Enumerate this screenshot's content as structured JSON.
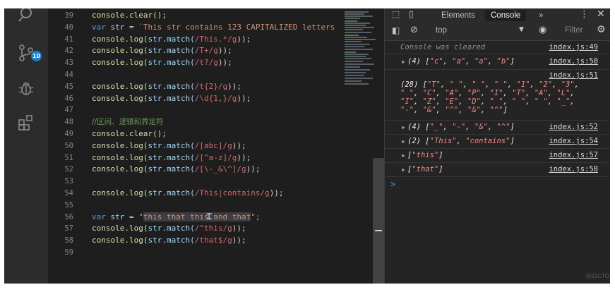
{
  "activity_bar": {
    "source_control_badge": "10"
  },
  "editor": {
    "lines": [
      {
        "num": "39"
      },
      {
        "num": "40"
      },
      {
        "num": "41"
      },
      {
        "num": "42"
      },
      {
        "num": "43"
      },
      {
        "num": "44"
      },
      {
        "num": "45"
      },
      {
        "num": "46"
      },
      {
        "num": "47"
      },
      {
        "num": "48"
      },
      {
        "num": "49"
      },
      {
        "num": "50"
      },
      {
        "num": "51"
      },
      {
        "num": "52"
      },
      {
        "num": "53"
      },
      {
        "num": "54"
      },
      {
        "num": "55"
      },
      {
        "num": "56"
      },
      {
        "num": "57"
      },
      {
        "num": "58"
      },
      {
        "num": "59"
      }
    ],
    "code": {
      "l39": "console.clear();",
      "l40_a": "var",
      "l40_b": "str",
      "l40_c": " = ",
      "l40_d": "`This str contains 123 CAPITALIZED letters",
      "l41": "/This.*/g",
      "l42": "/T+/g",
      "l43": "/t?/g",
      "l45": "/t{2}/g",
      "l46": "/\\d{1,}/g",
      "l48": "//区间、逻辑和界定符",
      "l49": "console.clear();",
      "l50": "/[abc]/g",
      "l51": "/[^a-z]/g",
      "l52": "/[\\-_&\\^]/g",
      "l54": "/This|contains/g",
      "l56_open": "\"",
      "l56_str": "this that this and that",
      "l56_close": "\";",
      "l57": "/^this/g",
      "l58": "/that$/g",
      "log_prefix": "console.log(",
      "match_prefix": "str.match(",
      "log_suffix": "));"
    }
  },
  "devtools": {
    "tabs": {
      "elements": "Elements",
      "console": "Console",
      "more": "»"
    },
    "toolbar": {
      "context": "top",
      "filter_placeholder": "Filter"
    },
    "messages": [
      {
        "text": "Console was cleared",
        "source": "index.js:49"
      },
      {
        "count": "(4)",
        "items": [
          "\"c\"",
          "\"a\"",
          "\"a\"",
          "\"b\""
        ],
        "source": "index.js:50"
      },
      {
        "count": "(28)",
        "source": "index.js:51",
        "wrap1": [
          "\"T\"",
          "\" \"",
          "\" \"",
          "\" \"",
          "\"1\"",
          "\"2\"",
          "\"3\""
        ],
        "wrap2": [
          "\" \"",
          "\"C\"",
          "\"A\"",
          "\"P\"",
          "\"I\"",
          "\"T\"",
          "\"A\"",
          "\"L\""
        ],
        "wrap3": [
          "\"I\"",
          "\"Z\"",
          "\"E\"",
          "\"D\"",
          "\" \"",
          "\" \"",
          "\" \"",
          "\"_\""
        ],
        "wrap4": [
          "\"-\"",
          "\"&\"",
          "\"^\"",
          "\"&\"",
          "\"^\""
        ]
      },
      {
        "count": "(4)",
        "items": [
          "\"_\"",
          "\"-\"",
          "\"&\"",
          "\"^\""
        ],
        "source": "index.js:52"
      },
      {
        "count": "(2)",
        "items": [
          "\"This\"",
          "\"contains\""
        ],
        "source": "index.js:54"
      },
      {
        "items": [
          "\"this\""
        ],
        "source": "index.js:57"
      },
      {
        "items": [
          "\"that\""
        ],
        "source": "index.js:58"
      }
    ],
    "prompt": ">"
  },
  "watermark": "@51CTO",
  "colors": {
    "editor_bg": "#1e1e1e",
    "keyword": "#569cd6",
    "function": "#dcdcaa",
    "string": "#ce9178",
    "regex": "#d16969",
    "badge": "#1a7fd4"
  }
}
